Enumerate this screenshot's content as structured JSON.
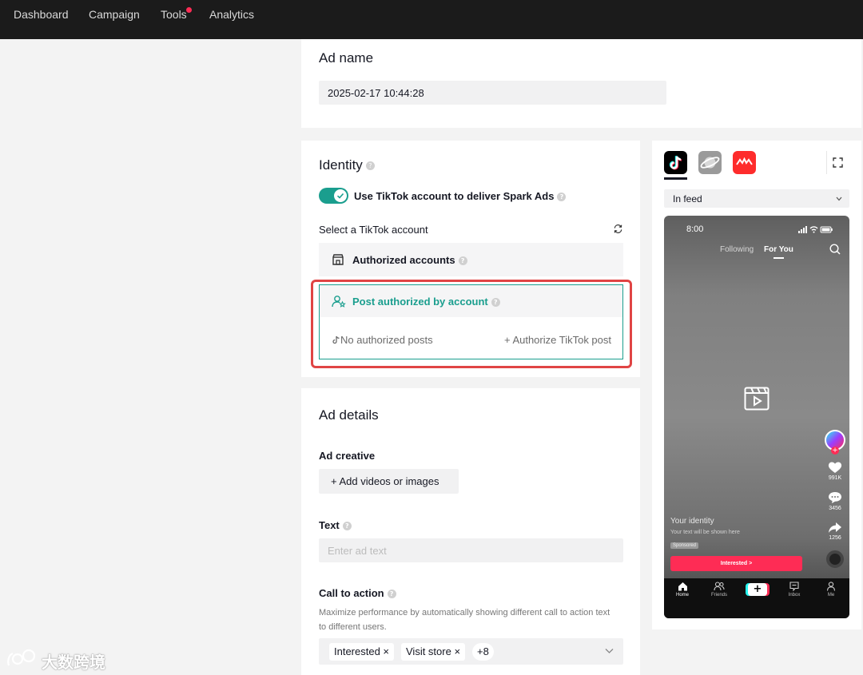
{
  "nav": {
    "items": [
      "Dashboard",
      "Campaign",
      "Tools",
      "Analytics"
    ]
  },
  "ad_name": {
    "title": "Ad name",
    "value": "2025-02-17 10:44:28"
  },
  "identity": {
    "title": "Identity",
    "toggle_label": "Use TikTok account to deliver Spark Ads",
    "toggle_on": true,
    "select_label": "Select a TikTok account",
    "authorized_accounts": "Authorized accounts",
    "post_authorized": "Post authorized by account",
    "no_posts": "No authorized posts",
    "authorize_link": "+ Authorize TikTok post"
  },
  "ad_details": {
    "title": "Ad details",
    "creative_label": "Ad creative",
    "add_media_button": "+   Add videos or images",
    "text_label": "Text",
    "text_placeholder": "Enter ad text",
    "cta_label": "Call to action",
    "cta_help_line1": "Maximize performance by automatically showing different call to action text",
    "cta_help_line2": "to different users.",
    "cta_chips": [
      "Interested ×",
      "Visit store ×",
      "+8"
    ]
  },
  "preview": {
    "placement_select": "In feed",
    "status_time": "8:00",
    "tab_following": "Following",
    "tab_for_you": "For You",
    "like_count": "991K",
    "comment_count": "3456",
    "share_count": "1256",
    "identity_name": "Your identity",
    "identity_text": "Your text will be shown here",
    "sponsored": "Sponsored",
    "cta_button": "Interested >",
    "bottom_tabs": [
      "Home",
      "Friends",
      "+",
      "Inbox",
      "Me"
    ]
  },
  "watermark": "大数跨境",
  "colors": {
    "accent": "#1a9e8e",
    "brand_red": "#fe2c55",
    "highlight_border": "#e04444",
    "topbar": "#1b1b1b"
  }
}
